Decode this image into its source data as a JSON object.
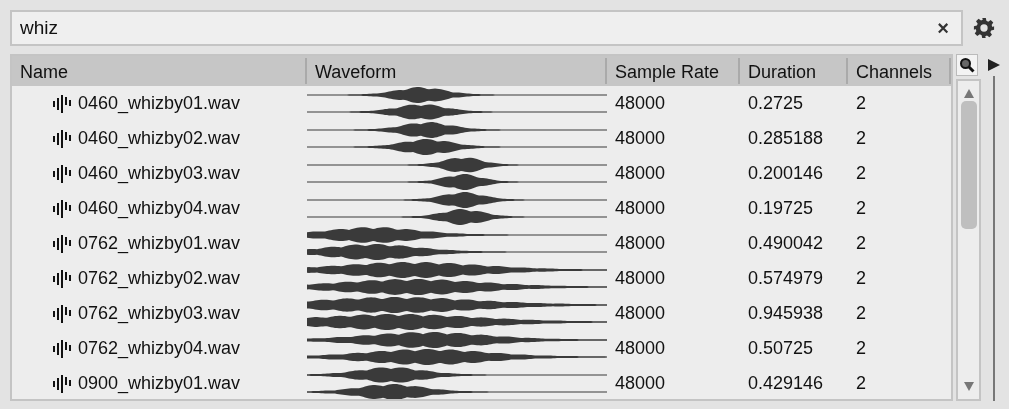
{
  "search": {
    "value": "whiz",
    "clear_button": "×"
  },
  "table": {
    "columns": [
      "Name",
      "Waveform",
      "Sample Rate",
      "Duration",
      "Channels"
    ],
    "rows": [
      {
        "name": "0460_whizby01.wav",
        "sample_rate": "48000",
        "duration": "0.2725",
        "channels": "2"
      },
      {
        "name": "0460_whizby02.wav",
        "sample_rate": "48000",
        "duration": "0.285188",
        "channels": "2"
      },
      {
        "name": "0460_whizby03.wav",
        "sample_rate": "48000",
        "duration": "0.200146",
        "channels": "2"
      },
      {
        "name": "0460_whizby04.wav",
        "sample_rate": "48000",
        "duration": "0.19725",
        "channels": "2"
      },
      {
        "name": "0762_whizby01.wav",
        "sample_rate": "48000",
        "duration": "0.490042",
        "channels": "2"
      },
      {
        "name": "0762_whizby02.wav",
        "sample_rate": "48000",
        "duration": "0.574979",
        "channels": "2"
      },
      {
        "name": "0762_whizby03.wav",
        "sample_rate": "48000",
        "duration": "0.945938",
        "channels": "2"
      },
      {
        "name": "0762_whizby04.wav",
        "sample_rate": "48000",
        "duration": "0.50725",
        "channels": "2"
      },
      {
        "name": "0900_whizby01.wav",
        "sample_rate": "48000",
        "duration": "0.429146",
        "channels": "2"
      }
    ]
  }
}
